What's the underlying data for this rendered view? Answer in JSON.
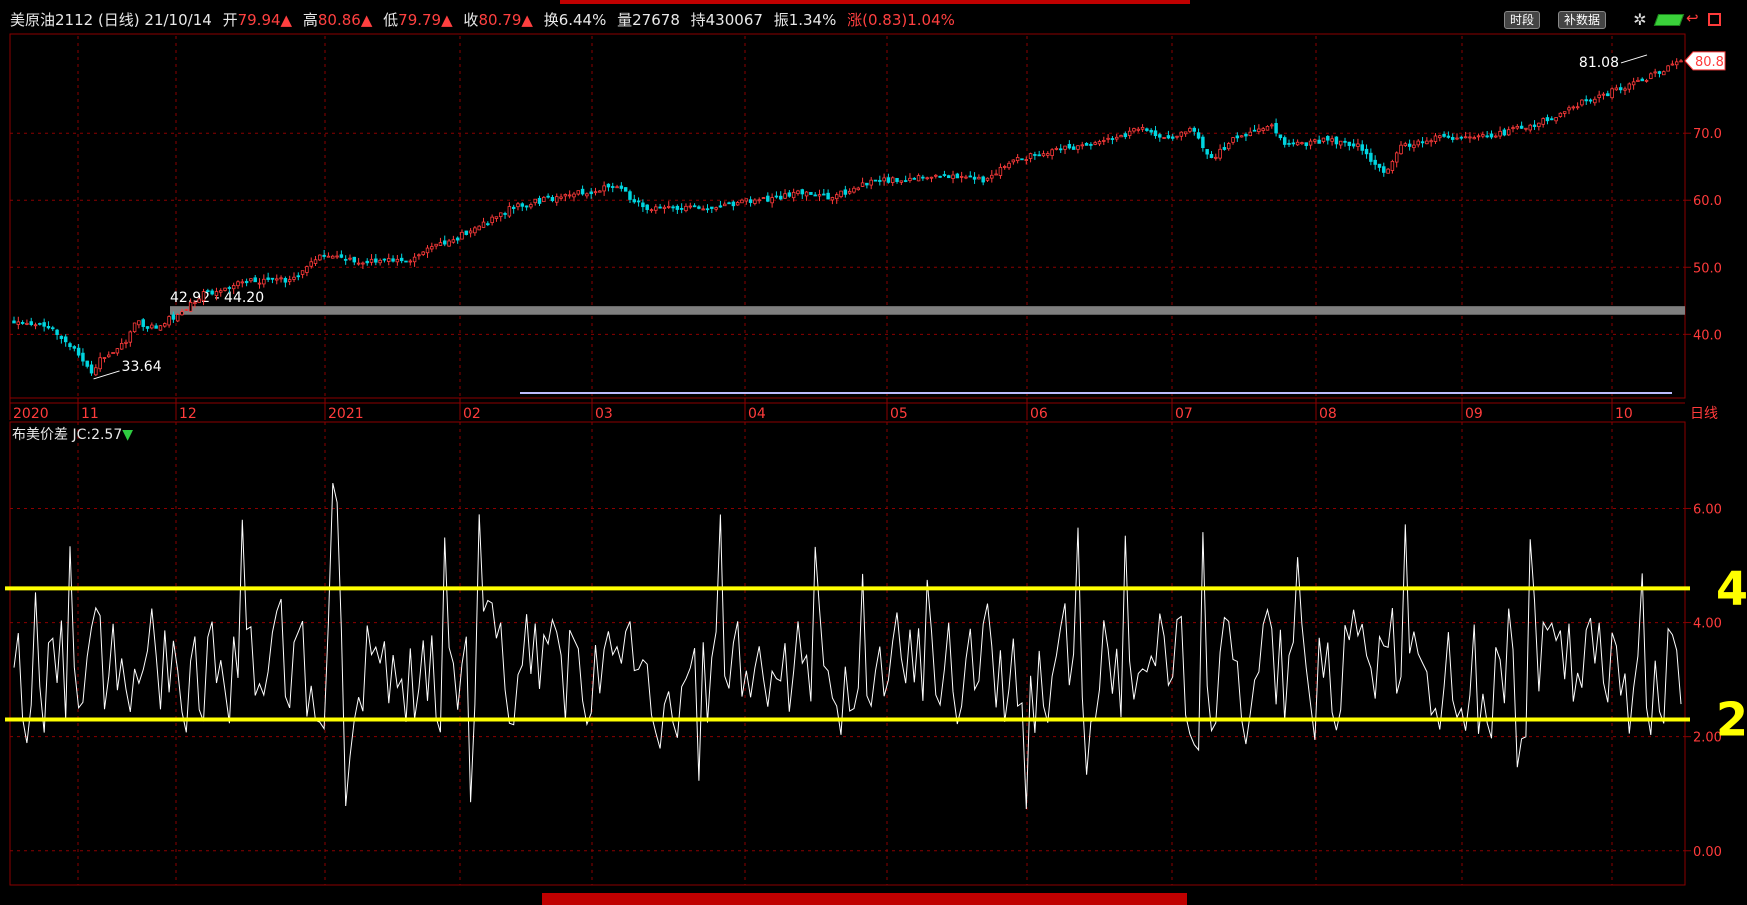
{
  "header": {
    "name": "美原油2112 (日线) 21/10/14",
    "open_label": "开",
    "open": "79.94▲",
    "high_label": "高",
    "high": "80.86▲",
    "low_label": "低",
    "low": "79.79▲",
    "close_label": "收",
    "close": "80.79▲",
    "turnover": "换6.44%",
    "volume": "量27678",
    "hold": "持430067",
    "amplitude": "振1.34%",
    "change": "涨(0.83)1.04%"
  },
  "toolbar": {
    "period_button": "时段",
    "supplement_button": "补数据"
  },
  "colors": {
    "up": "#ff3b3b",
    "down": "#00d5e0",
    "grid": "#8b0000",
    "band": "#7f7f7f",
    "threshold": "#ffff00",
    "indicator_line": "#ffffff"
  },
  "indicator": {
    "label": "布美价差 JC:2.57",
    "arrow": "▼"
  },
  "chart_data": [
    {
      "type": "candlestick",
      "title": "美原油2112 (日线)",
      "y_ticks": [
        "70.0",
        "60.0",
        "50.0",
        "40.0"
      ],
      "y_tick_values": [
        70,
        60,
        50,
        40
      ],
      "ylim": [
        30.5,
        84.5
      ],
      "last_price_tag": "80.8",
      "x_labels": [
        "2020",
        "11",
        "12",
        "2021",
        "02",
        "03",
        "04",
        "05",
        "06",
        "07",
        "08",
        "09",
        "10",
        "日线"
      ],
      "annotations": {
        "low": "33.64",
        "high": "81.08",
        "band_label": "42.92 - 44.20",
        "band": [
          42.92,
          44.2
        ]
      },
      "path_anchors": [
        [
          0,
          42
        ],
        [
          9,
          41
        ],
        [
          14,
          38
        ],
        [
          16,
          36
        ],
        [
          18,
          34
        ],
        [
          20,
          36.5
        ],
        [
          23,
          37
        ],
        [
          26,
          39
        ],
        [
          28,
          42
        ],
        [
          32,
          41
        ],
        [
          37,
          42.5
        ],
        [
          44,
          46
        ],
        [
          54,
          48
        ],
        [
          64,
          48
        ],
        [
          72,
          52
        ],
        [
          80,
          51
        ],
        [
          91,
          51
        ],
        [
          98,
          53
        ],
        [
          108,
          56
        ],
        [
          116,
          59
        ],
        [
          130,
          61
        ],
        [
          140,
          62
        ],
        [
          147,
          58.5
        ],
        [
          160,
          59
        ],
        [
          172,
          60
        ],
        [
          182,
          61
        ],
        [
          190,
          60.5
        ],
        [
          200,
          63
        ],
        [
          215,
          63.5
        ],
        [
          225,
          63
        ],
        [
          232,
          66
        ],
        [
          246,
          68
        ],
        [
          258,
          69.5
        ],
        [
          262,
          71
        ],
        [
          266,
          69
        ],
        [
          274,
          70.5
        ],
        [
          278,
          66
        ],
        [
          284,
          69.5
        ],
        [
          292,
          71
        ],
        [
          296,
          68
        ],
        [
          305,
          69
        ],
        [
          312,
          68
        ],
        [
          318,
          64
        ],
        [
          322,
          68
        ],
        [
          330,
          69.5
        ],
        [
          336,
          69
        ],
        [
          346,
          70
        ],
        [
          356,
          72
        ],
        [
          364,
          74.5
        ],
        [
          370,
          76
        ],
        [
          374,
          77
        ],
        [
          382,
          79
        ],
        [
          387,
          80.79
        ]
      ],
      "n_bars": 388
    },
    {
      "type": "line",
      "title": "布美价差",
      "series_name": "JC",
      "y_ticks": [
        "6.00",
        "4.00",
        "2.00",
        "0.00"
      ],
      "y_tick_values": [
        6,
        4,
        2,
        0
      ],
      "ylim": [
        -0.6,
        7.2
      ],
      "threshold_lines": [
        4.6,
        2.3
      ],
      "threshold_labels": [
        "4",
        "2"
      ],
      "n_points": 388
    }
  ]
}
